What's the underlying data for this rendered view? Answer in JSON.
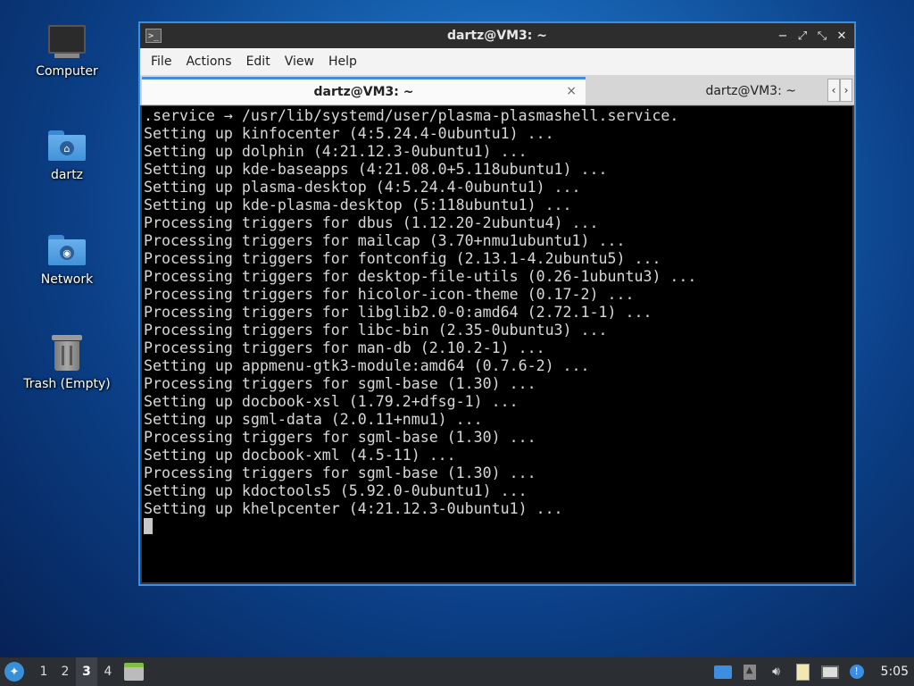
{
  "desktop": {
    "icons": [
      {
        "label": "Computer",
        "icon": "computer-icon"
      },
      {
        "label": "dartz",
        "icon": "home-folder-icon"
      },
      {
        "label": "Network",
        "icon": "network-folder-icon"
      },
      {
        "label": "Trash (Empty)",
        "icon": "trash-icon"
      }
    ]
  },
  "window": {
    "title": "dartz@VM3: ~",
    "controls": {
      "minimize": "−",
      "maximize": "⤢",
      "restore": "⤡",
      "close": "✕"
    },
    "menu": [
      "File",
      "Actions",
      "Edit",
      "View",
      "Help"
    ],
    "tabs": [
      {
        "label": "dartz@VM3: ~",
        "active": true,
        "close": "×"
      },
      {
        "label": "dartz@VM3: ~",
        "active": false
      }
    ],
    "tab_scroll": {
      "left": "‹",
      "right": "›"
    },
    "terminal_lines": [
      ".service → /usr/lib/systemd/user/plasma-plasmashell.service.",
      "Setting up kinfocenter (4:5.24.4-0ubuntu1) ...",
      "Setting up dolphin (4:21.12.3-0ubuntu1) ...",
      "Setting up kde-baseapps (4:21.08.0+5.118ubuntu1) ...",
      "Setting up plasma-desktop (4:5.24.4-0ubuntu1) ...",
      "Setting up kde-plasma-desktop (5:118ubuntu1) ...",
      "Processing triggers for dbus (1.12.20-2ubuntu4) ...",
      "Processing triggers for mailcap (3.70+nmu1ubuntu1) ...",
      "Processing triggers for fontconfig (2.13.1-4.2ubuntu5) ...",
      "Processing triggers for desktop-file-utils (0.26-1ubuntu3) ...",
      "Processing triggers for hicolor-icon-theme (0.17-2) ...",
      "Processing triggers for libglib2.0-0:amd64 (2.72.1-1) ...",
      "Processing triggers for libc-bin (2.35-0ubuntu3) ...",
      "Processing triggers for man-db (2.10.2-1) ...",
      "Setting up appmenu-gtk3-module:amd64 (0.7.6-2) ...",
      "Processing triggers for sgml-base (1.30) ...",
      "Setting up docbook-xsl (1.79.2+dfsg-1) ...",
      "Setting up sgml-data (2.0.11+nmu1) ...",
      "Processing triggers for sgml-base (1.30) ...",
      "Setting up docbook-xml (4.5-11) ...",
      "Processing triggers for sgml-base (1.30) ...",
      "Setting up kdoctools5 (5.92.0-0ubuntu1) ...",
      "Setting up khelpcenter (4:21.12.3-0ubuntu1) ..."
    ]
  },
  "taskbar": {
    "workspaces": [
      "1",
      "2",
      "3",
      "4"
    ],
    "active_workspace": "3",
    "clock": "5:05",
    "tray_icons": [
      "desktop-icon",
      "eject-icon",
      "volume-icon",
      "clipboard-icon",
      "network-monitor-icon",
      "update-notifier-icon"
    ]
  },
  "colors": {
    "accent": "#3d8ee0",
    "terminal_bg": "#000000",
    "terminal_fg": "#d8d8d8"
  }
}
